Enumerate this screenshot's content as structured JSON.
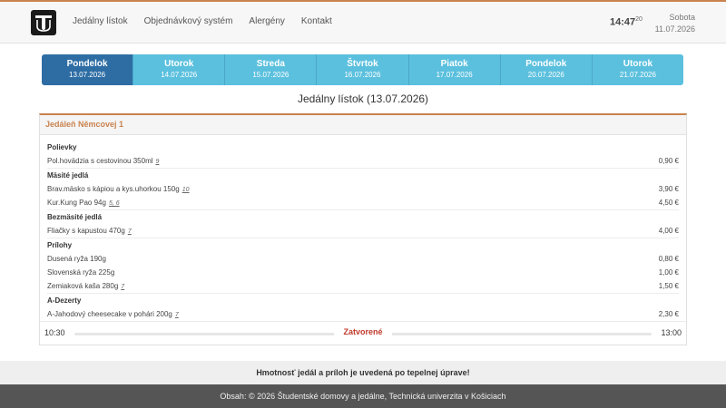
{
  "nav": {
    "logo_icon": "tuke-logo-icon",
    "items": [
      "Jedálny lístok",
      "Objednávkový systém",
      "Alergény",
      "Kontakt"
    ]
  },
  "clock": {
    "time": "14:47",
    "seconds": "20"
  },
  "today": {
    "weekday": "Sobota",
    "date": "11.07.2026"
  },
  "days": [
    {
      "name": "Pondelok",
      "date": "13.07.2026",
      "active": true
    },
    {
      "name": "Utorok",
      "date": "14.07.2026"
    },
    {
      "name": "Streda",
      "date": "15.07.2026"
    },
    {
      "name": "Štvrtok",
      "date": "16.07.2026"
    },
    {
      "name": "Piatok",
      "date": "17.07.2026"
    },
    {
      "name": "Pondelok",
      "date": "20.07.2026"
    },
    {
      "name": "Utorok",
      "date": "21.07.2026"
    }
  ],
  "page_title": "Jedálny lístok (13.07.2026)",
  "canteen": {
    "name": "Jedáleň Němcovej 1",
    "categories": [
      {
        "name": "Polievky",
        "items": [
          {
            "label": "Pol.hovädzia s cestovinou 350ml",
            "allergens": "9",
            "price": "0,90 €"
          }
        ]
      },
      {
        "name": "Mäsité jedlá",
        "items": [
          {
            "label": "Brav.mäsko s kápiou a kys.uhorkou 150g",
            "allergens": "10",
            "price": "3,90 €"
          },
          {
            "label": "Kur.Kung Pao 94g",
            "allergens": "5, 6",
            "price": "4,50 €"
          }
        ]
      },
      {
        "name": "Bezmäsité jedlá",
        "items": [
          {
            "label": "Fliačky s kapustou 470g",
            "allergens": "7",
            "price": "4,00 €"
          }
        ]
      },
      {
        "name": "Prílohy",
        "items": [
          {
            "label": "Dusená ryža 190g",
            "allergens": "",
            "price": "0,80 €"
          },
          {
            "label": "Slovenská ryža 225g",
            "allergens": "",
            "price": "1,00 €"
          },
          {
            "label": "Zemiaková kaša 280g",
            "allergens": "7",
            "price": "1,50 €"
          }
        ]
      },
      {
        "name": "A-Dezerty",
        "items": [
          {
            "label": "A-Jahodový cheesecake v pohári 200g",
            "allergens": "7",
            "price": "2,30 €"
          }
        ]
      }
    ],
    "hours": {
      "open": "10:30",
      "close": "13:00",
      "status": "Zatvorené"
    }
  },
  "notice": "Hmotnosť jedál a príloh je uvedená po tepelnej úprave!",
  "footer": "Obsah: © 2026 Študentské domovy a jedálne, Technická univerzita v Košiciach",
  "colors": {
    "accent": "#c9834f",
    "tab": "#5bc0de",
    "tab_active": "#2e6da4",
    "closed": "#c0392b"
  }
}
